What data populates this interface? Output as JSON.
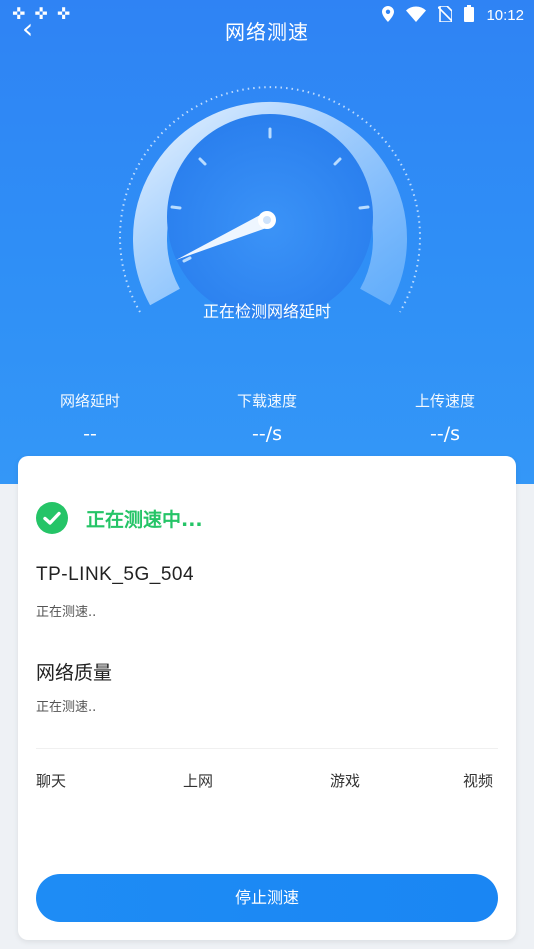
{
  "status_bar": {
    "time": "10:12",
    "left_icons": [
      "notification-icon",
      "notification-icon",
      "notification-icon"
    ],
    "right_icons": [
      "location-icon",
      "wifi-icon",
      "no-sim-icon",
      "battery-icon"
    ]
  },
  "header": {
    "title": "网络测速",
    "back_icon": "back-arrow-icon"
  },
  "gauge": {
    "status_text": "正在检测网络延时"
  },
  "metrics": [
    {
      "label": "网络延时",
      "value": "--"
    },
    {
      "label": "下载速度",
      "value": "--/s"
    },
    {
      "label": "上传速度",
      "value": "--/s"
    }
  ],
  "card": {
    "testing_label": "正在测速中...",
    "ssid": "TP-LINK_5G_504",
    "ssid_status": "正在测速..",
    "quality_title": "网络质量",
    "quality_status": "正在测速..",
    "categories": [
      "聊天",
      "上网",
      "游戏",
      "视频"
    ],
    "stop_button": "停止测速"
  },
  "colors": {
    "primary_blue": "#2f83f4",
    "success_green": "#25c467",
    "button_blue": "#1e8cf5"
  }
}
